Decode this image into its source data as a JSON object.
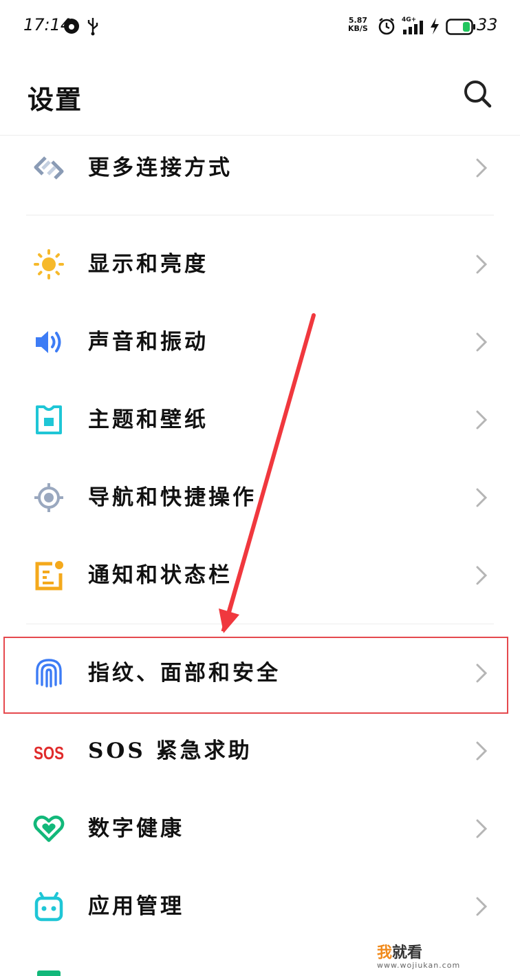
{
  "status_bar": {
    "time": "17:14",
    "net_speed_value": "5.87",
    "net_speed_unit": "KB/S",
    "network": "4G+",
    "battery": "33"
  },
  "header": {
    "title": "设置"
  },
  "items": [
    {
      "label": "更多连接方式",
      "icon": "link-icon",
      "color": "#8a9bb5"
    },
    {
      "label": "显示和亮度",
      "icon": "sun-icon",
      "color": "#f6b92b"
    },
    {
      "label": "声音和振动",
      "icon": "speaker-icon",
      "color": "#3d7cf5"
    },
    {
      "label": "主题和壁纸",
      "icon": "theme-icon",
      "color": "#1fc6d6"
    },
    {
      "label": "导航和快捷操作",
      "icon": "navigation-icon",
      "color": "#9aa8bf"
    },
    {
      "label": "通知和状态栏",
      "icon": "notification-icon",
      "color": "#f4a91c"
    },
    {
      "label": "指纹、面部和安全",
      "icon": "fingerprint-icon",
      "color": "#3d7cf5"
    },
    {
      "label": "SOS 紧急求助",
      "icon": "sos-icon",
      "color": "#e02b2b"
    },
    {
      "label": "数字健康",
      "icon": "heart-icon",
      "color": "#12b87a"
    },
    {
      "label": "应用管理",
      "icon": "app-manager-icon",
      "color": "#1fc6d6"
    }
  ],
  "watermark": {
    "brand_a": "我",
    "brand_b": "就看",
    "url": "www.wojiukan.com"
  },
  "colors": {
    "highlight": "#e5484d",
    "arrow": "#f0383e"
  }
}
